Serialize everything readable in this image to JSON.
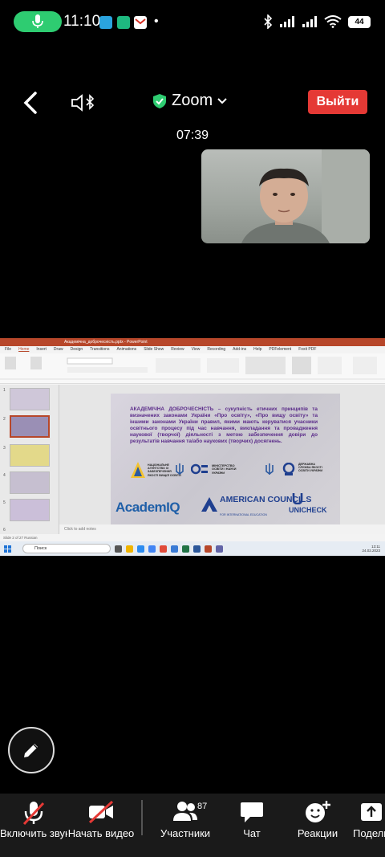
{
  "status": {
    "time": "11:10",
    "battery": "44"
  },
  "topbar": {
    "app_title": "Zoom",
    "leave_label": "Выйти"
  },
  "timer": "07:39",
  "powerpoint": {
    "window_title": "Академічна_доброчесність.pptx - PowerPoint",
    "tabs": [
      "File",
      "Home",
      "Insert",
      "Draw",
      "Design",
      "Transitions",
      "Animations",
      "Slide Show",
      "Review",
      "View",
      "Recording",
      "Add-ins",
      "Help",
      "PDFelement",
      "Foxit PDF"
    ],
    "slide_text": "АКАДЕМІЧНА ДОБРОЧЕСНІСТЬ – сукупність етичних принципів та визначених законами України «Про освіту», «Про вищу освіту» та іншими законами України правил, якими мають керуватися учасники освітнього процесу під час навчання, викладання та провадження наукової (творчої) діяльності з метою забезпечення довіри до результатів навчання та/або наукових (творчих) досягнень.",
    "logos": {
      "agency": "НАЦІОНАЛЬНЕ АГЕНТСТВО ІЗ ЗАБЕЗПЕЧЕННЯ ЯКОСТІ ВИЩОЇ ОСВІТИ",
      "ministry": "МІНІСТЕРСТВО ОСВІТИ І НАУКИ УКРАЇНИ",
      "service": "ДЕРЖАВНА СЛУЖБА ЯКОСТІ ОСВІТИ УКРАЇНИ",
      "academiq": "AcademIQ",
      "american_councils": "AMERICAN COUNCILS",
      "american_councils_sub": "FOR INTERNATIONAL EDUCATION",
      "unicheck": "UNICHECK"
    },
    "notes_placeholder": "Click to add notes",
    "status_bar": "Slide 2 of 27    Russian",
    "taskbar_search": "Поиск",
    "taskbar_time": "13:11",
    "taskbar_date": "24.02.2023"
  },
  "bottombar": {
    "audio_label": "Включить звук",
    "video_label": "Начать видео",
    "participants_label": "Участники",
    "participants_count": "87",
    "chat_label": "Чат",
    "reactions_label": "Реакции",
    "share_label": "Поделиться"
  },
  "colors": {
    "leave_red": "#e53935",
    "mic_green": "#2ecc71",
    "shield_green": "#2ecc71",
    "ppt_red": "#b7472a",
    "slide_text_purple": "#5b2c8a"
  }
}
